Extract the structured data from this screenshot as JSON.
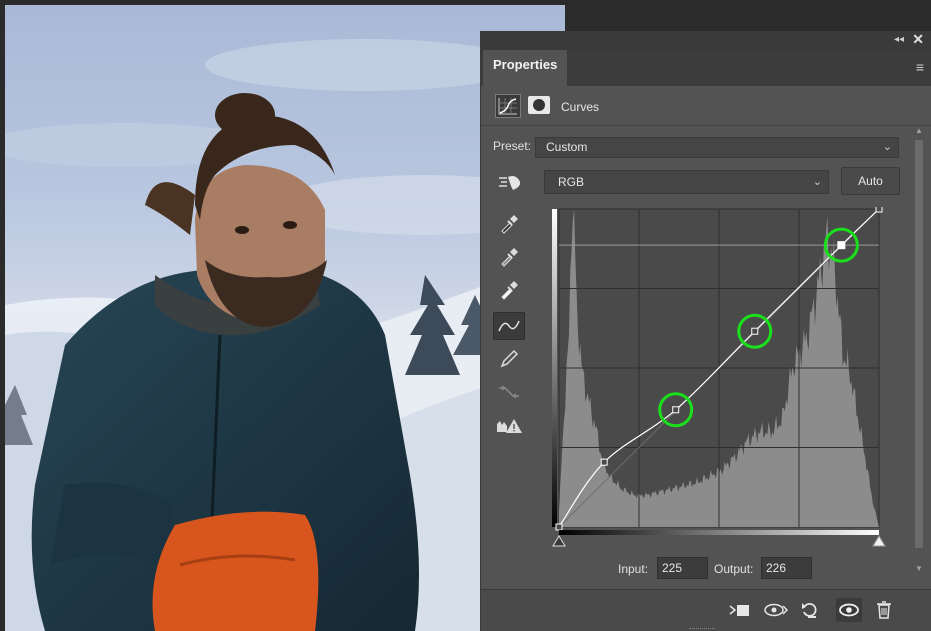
{
  "panel": {
    "tab_label": "Properties",
    "adjustment_title": "Curves",
    "preset_label": "Preset:",
    "preset_value": "Custom",
    "channel_value": "RGB",
    "auto_label": "Auto",
    "input_label": "Input:",
    "input_value": "225",
    "output_label": "Output:",
    "output_value": "226"
  },
  "icons": {
    "panel": [
      "collapse-icon",
      "close-icon",
      "panel-menu-icon",
      "curves-layer-icon",
      "mask-icon"
    ],
    "tools": [
      "on-image-adjust-icon",
      "black-point-eyedropper-icon",
      "gray-point-eyedropper-icon",
      "white-point-eyedropper-icon",
      "edit-points-curve-icon",
      "draw-curve-pencil-icon",
      "smooth-curve-icon",
      "clipping-warning-icon"
    ],
    "footer": [
      "clip-to-layer-icon",
      "view-previous-state-icon",
      "reset-icon",
      "visibility-eye-icon",
      "trash-icon"
    ]
  },
  "colors": {
    "panel_bg": "#535353",
    "highlight_circle": "#19e01a",
    "curve": "#ffffff",
    "histogram": "#888888"
  },
  "curve": {
    "input_range": [
      0,
      255
    ],
    "output_range": [
      0,
      255
    ],
    "points": [
      [
        0,
        0
      ],
      [
        36,
        52
      ],
      [
        93,
        94
      ],
      [
        156,
        157
      ],
      [
        225,
        226
      ],
      [
        255,
        255
      ]
    ],
    "highlighted_points": [
      [
        93,
        94
      ],
      [
        156,
        157
      ],
      [
        225,
        226
      ]
    ],
    "selected_point": [
      225,
      226
    ]
  }
}
